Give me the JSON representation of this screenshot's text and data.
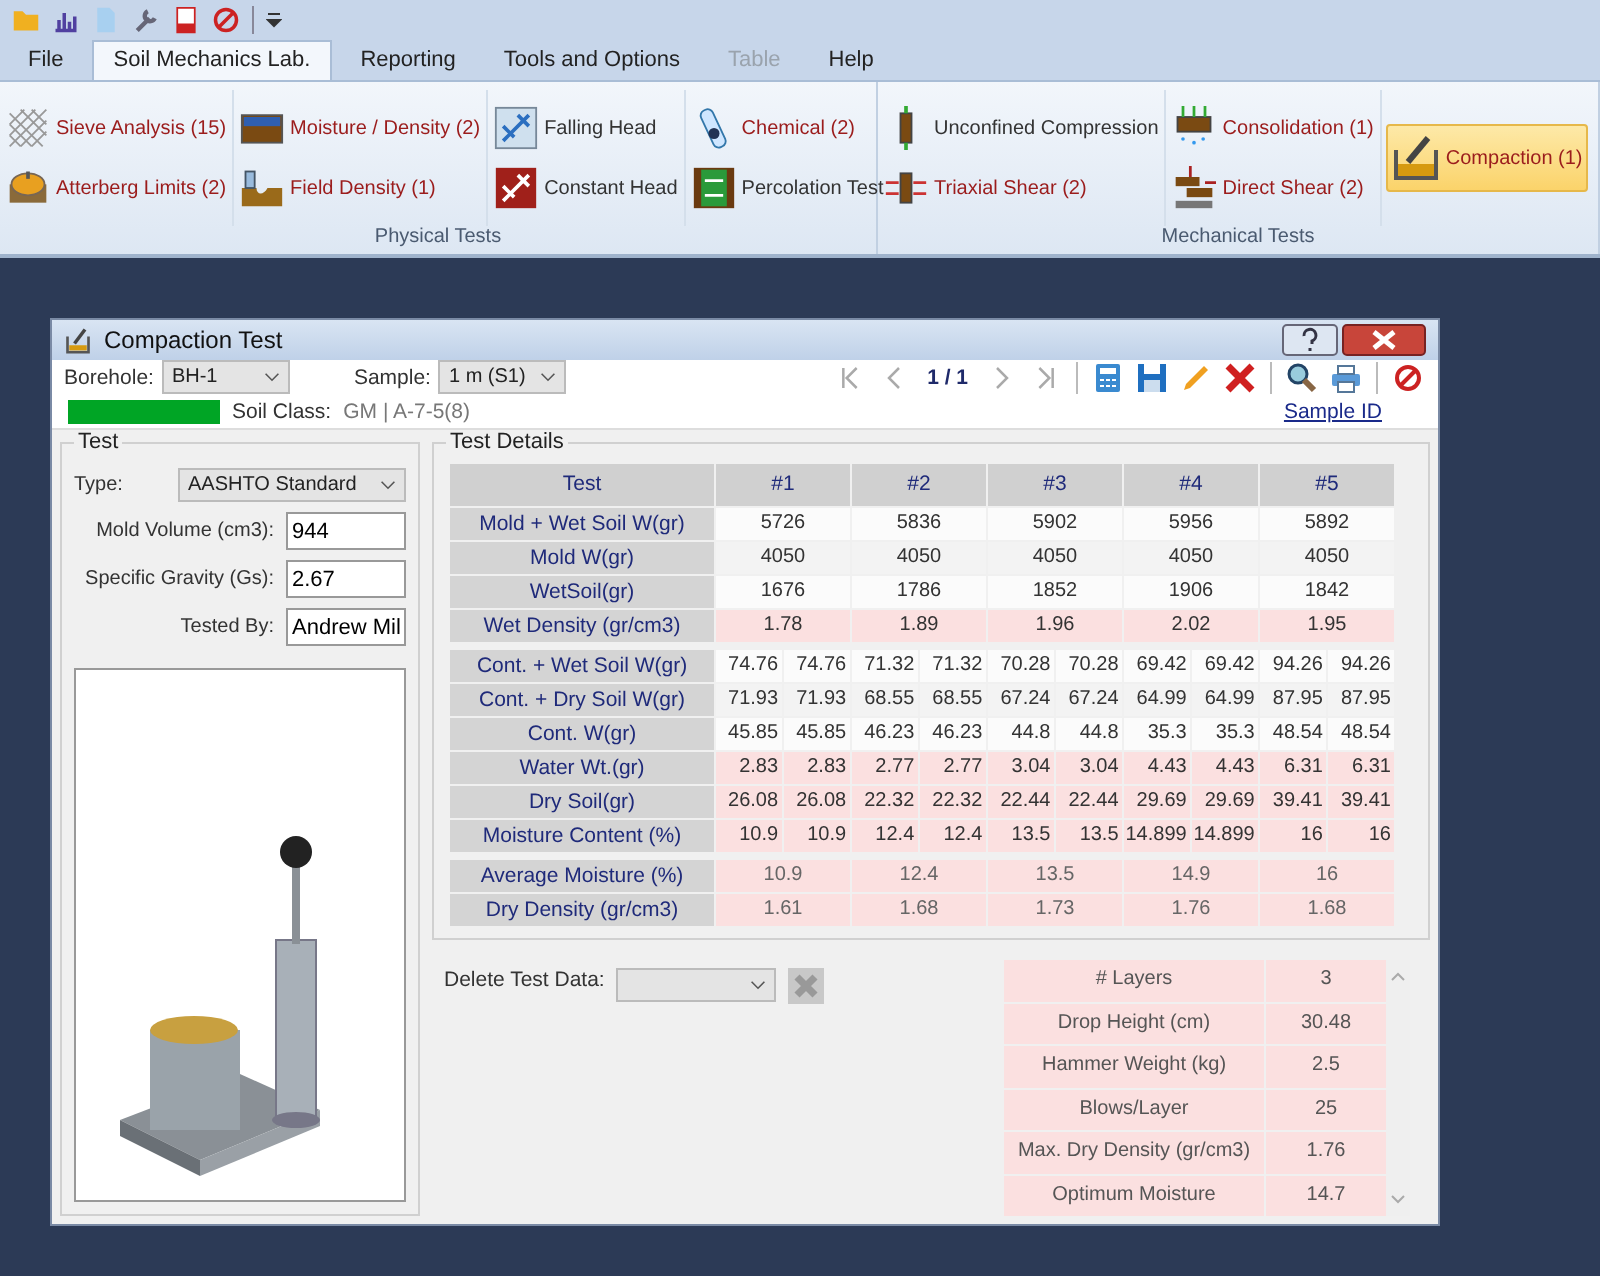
{
  "menu_tabs": [
    {
      "label": "File",
      "selected": false,
      "disabled": false
    },
    {
      "label": "Soil Mechanics Lab.",
      "selected": true,
      "disabled": false
    },
    {
      "label": "Reporting",
      "selected": false,
      "disabled": false
    },
    {
      "label": "Tools and Options",
      "selected": false,
      "disabled": false
    },
    {
      "label": "Table",
      "selected": false,
      "disabled": true
    },
    {
      "label": "Help",
      "selected": false,
      "disabled": false
    }
  ],
  "ribbon": [
    {
      "title": "Physical Tests",
      "columns": [
        [
          {
            "label": "Sieve Analysis (15)",
            "kind": "small",
            "has_records": true,
            "selected": false
          },
          {
            "label": "Atterberg Limits (2)",
            "kind": "small",
            "has_records": true,
            "selected": false
          }
        ],
        [
          {
            "label": "Moisture / Density (2)",
            "kind": "small",
            "has_records": true,
            "selected": false
          },
          {
            "label": "Field Density (1)",
            "kind": "small",
            "has_records": true,
            "selected": false
          }
        ],
        [
          {
            "label": "Falling Head",
            "kind": "small",
            "has_records": false,
            "selected": false
          },
          {
            "label": "Constant Head",
            "kind": "small",
            "has_records": false,
            "selected": false
          }
        ],
        [
          {
            "label": "Chemical (2)",
            "kind": "small",
            "has_records": true,
            "selected": false
          },
          {
            "label": "Percolation Test",
            "kind": "small",
            "has_records": false,
            "selected": false
          }
        ]
      ]
    },
    {
      "title": "Mechanical Tests",
      "columns": [
        [
          {
            "label": "Unconfined Compression",
            "kind": "small",
            "has_records": false,
            "selected": false
          },
          {
            "label": "Triaxial Shear (2)",
            "kind": "small",
            "has_records": true,
            "selected": false
          }
        ],
        [
          {
            "label": "Consolidation (1)",
            "kind": "small",
            "has_records": true,
            "selected": false
          },
          {
            "label": "Direct Shear (2)",
            "kind": "small",
            "has_records": true,
            "selected": false
          }
        ],
        [
          {
            "label": "Compaction (1)",
            "kind": "large",
            "has_records": true,
            "selected": true
          }
        ]
      ]
    }
  ],
  "dialog": {
    "title": "Compaction Test",
    "borehole": {
      "label": "Borehole:",
      "value": "BH-1"
    },
    "sample": {
      "label": "Sample:",
      "value": "1 m (S1)"
    },
    "pager": "1 / 1",
    "soil_class": {
      "color": "#00a525",
      "label": "Soil Class:",
      "value": "GM | A-7-5(8)"
    },
    "sample_id_link": "Sample ID",
    "test": {
      "title": "Test",
      "fields": [
        {
          "kind": "dropdown",
          "label": "Type:",
          "value": "AASHTO Standard"
        },
        {
          "kind": "input",
          "label": "Mold Volume  (cm3):",
          "value": "944"
        },
        {
          "kind": "input",
          "label": "Specific Gravity (Gs):",
          "value": "2.67"
        },
        {
          "kind": "input",
          "label": "Tested By:",
          "value": "Andrew Mil"
        }
      ]
    },
    "details": {
      "title": "Test Details",
      "header": [
        "Test",
        "#1",
        "#2",
        "#3",
        "#4",
        "#5"
      ],
      "density_rows": [
        {
          "label": "Mold + Wet Soil W(gr)",
          "computed": false,
          "values": [
            "5726",
            "5836",
            "5902",
            "5956",
            "5892"
          ]
        },
        {
          "label": "Mold W(gr)",
          "computed": false,
          "values": [
            "4050",
            "4050",
            "4050",
            "4050",
            "4050"
          ]
        },
        {
          "label": "WetSoil(gr)",
          "computed": false,
          "values": [
            "1676",
            "1786",
            "1852",
            "1906",
            "1842"
          ]
        },
        {
          "label": "Wet Density (gr/cm3)",
          "computed": true,
          "values": [
            "1.78",
            "1.89",
            "1.96",
            "2.02",
            "1.95"
          ]
        }
      ],
      "moisture_rows": [
        {
          "label": "Cont. + Wet Soil W(gr)",
          "computed": false,
          "values": [
            "74.76",
            "74.76",
            "71.32",
            "71.32",
            "70.28",
            "70.28",
            "69.42",
            "69.42",
            "94.26",
            "94.26"
          ]
        },
        {
          "label": "Cont. + Dry Soil W(gr)",
          "computed": false,
          "values": [
            "71.93",
            "71.93",
            "68.55",
            "68.55",
            "67.24",
            "67.24",
            "64.99",
            "64.99",
            "87.95",
            "87.95"
          ]
        },
        {
          "label": "Cont. W(gr)",
          "computed": false,
          "values": [
            "45.85",
            "45.85",
            "46.23",
            "46.23",
            "44.8",
            "44.8",
            "35.3",
            "35.3",
            "48.54",
            "48.54"
          ]
        },
        {
          "label": "Water Wt.(gr)",
          "computed": true,
          "values": [
            "2.83",
            "2.83",
            "2.77",
            "2.77",
            "3.04",
            "3.04",
            "4.43",
            "4.43",
            "6.31",
            "6.31"
          ]
        },
        {
          "label": "Dry Soil(gr)",
          "computed": true,
          "values": [
            "26.08",
            "26.08",
            "22.32",
            "22.32",
            "22.44",
            "22.44",
            "29.69",
            "29.69",
            "39.41",
            "39.41"
          ]
        },
        {
          "label": "Moisture Content (%)",
          "computed": true,
          "values": [
            "10.9",
            "10.9",
            "12.4",
            "12.4",
            "13.5",
            "13.5",
            "14.899",
            "14.899",
            "16",
            "16"
          ]
        }
      ],
      "summary_rows": [
        {
          "label": "Average Moisture (%)",
          "computed": true,
          "values": [
            "10.9",
            "12.4",
            "13.5",
            "14.9",
            "16"
          ]
        },
        {
          "label": "Dry Density (gr/cm3)",
          "computed": true,
          "values": [
            "1.61",
            "1.68",
            "1.73",
            "1.76",
            "1.68"
          ]
        }
      ]
    },
    "delete": {
      "label": "Delete Test Data:"
    },
    "results": [
      {
        "label": "# Layers",
        "value": "3"
      },
      {
        "label": "Drop Height (cm)",
        "value": "30.48"
      },
      {
        "label": "Hammer Weight (kg)",
        "value": "2.5"
      },
      {
        "label": "Blows/Layer",
        "value": "25"
      },
      {
        "label": "Max. Dry Density (gr/cm3)",
        "value": "1.76"
      },
      {
        "label": "Optimum Moisture",
        "value": "14.7"
      }
    ]
  }
}
